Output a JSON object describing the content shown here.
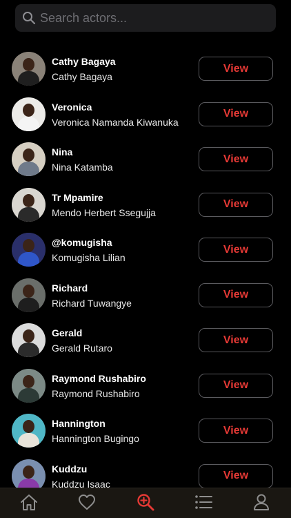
{
  "search": {
    "placeholder": "Search actors..."
  },
  "actors": [
    {
      "name": "Cathy Bagaya",
      "full_name": "Cathy Bagaya",
      "button": "View"
    },
    {
      "name": "Veronica",
      "full_name": "Veronica Namanda Kiwanuka",
      "button": "View"
    },
    {
      "name": "Nina",
      "full_name": "Nina Katamba",
      "button": "View"
    },
    {
      "name": "Tr Mpamire",
      "full_name": "Mendo Herbert Ssegujja",
      "button": "View"
    },
    {
      "name": "@komugisha",
      "full_name": "Komugisha Lilian",
      "button": "View"
    },
    {
      "name": "Richard",
      "full_name": "Richard Tuwangye",
      "button": "View"
    },
    {
      "name": "Gerald",
      "full_name": "Gerald Rutaro",
      "button": "View"
    },
    {
      "name": "Raymond Rushabiro",
      "full_name": "Raymond Rushabiro",
      "button": "View"
    },
    {
      "name": "Hannington",
      "full_name": "Hannington Bugingo",
      "button": "View"
    },
    {
      "name": "Kuddzu",
      "full_name": "Kuddzu Isaac",
      "button": "View"
    }
  ],
  "tabbar": {
    "items": [
      {
        "icon": "home-icon",
        "active": false
      },
      {
        "icon": "heart-icon",
        "active": false
      },
      {
        "icon": "search-zoom-icon",
        "active": true
      },
      {
        "icon": "list-icon",
        "active": false
      },
      {
        "icon": "user-icon",
        "active": false
      }
    ],
    "active_color": "#e53935",
    "inactive_color": "#8e8e8e"
  },
  "colors": {
    "background": "#000000",
    "accent": "#e53935",
    "search_bg": "#1c1c1e",
    "tabbar_bg": "#1a1712"
  }
}
